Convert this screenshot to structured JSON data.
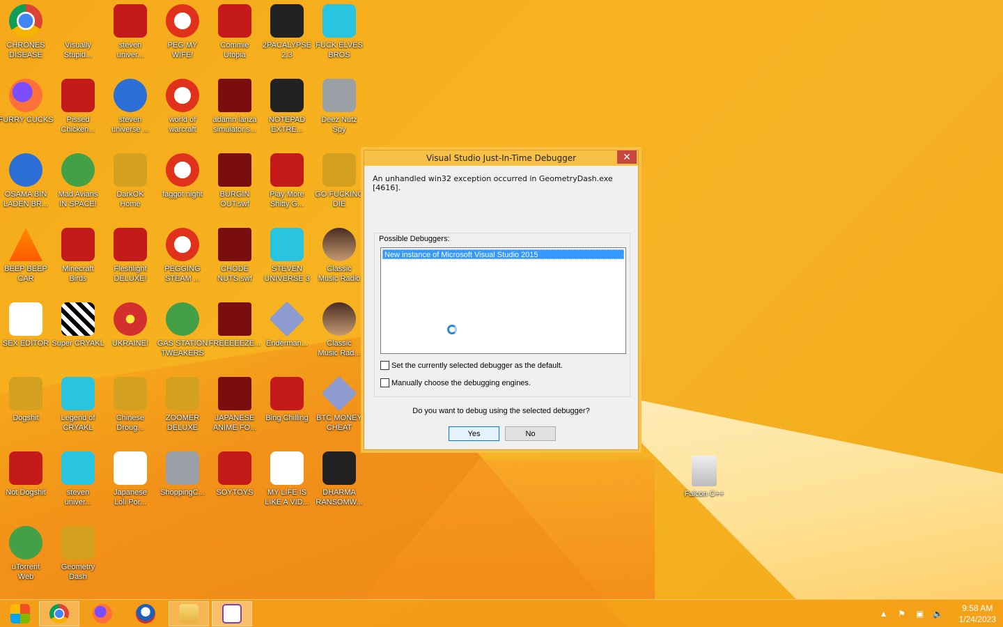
{
  "desktop": {
    "icons": [
      {
        "label": "CHRONES\nDISEASE",
        "icon": "chrome-icon"
      },
      {
        "label": "Visually\nStupid...",
        "icon": "visual-studio-icon"
      },
      {
        "label": "steven\nuniver...",
        "icon": "game-icon"
      },
      {
        "label": "PEG MY\nWIFE!",
        "icon": "peggle-icon"
      },
      {
        "label": "Commie\nUtopia",
        "icon": "eagle-icon"
      },
      {
        "label": "2PACALYPSE\n2.3",
        "icon": "terminal-icon"
      },
      {
        "label": "FUCK ELVES\nBROS",
        "icon": "elf-icon"
      },
      {
        "label": "FURRY CUCKS",
        "icon": "firefox-icon"
      },
      {
        "label": "Pissed\nChicken...",
        "icon": "angry-birds-icon"
      },
      {
        "label": "steven\nuniverse ...",
        "icon": "gem-icon"
      },
      {
        "label": "world of\nwarcraft",
        "icon": "peggle-icon"
      },
      {
        "label": "adamn lanza\nsimulator.s...",
        "icon": "flash-icon"
      },
      {
        "label": "NOTEPAD\nEXTRE...",
        "icon": "notepad-icon"
      },
      {
        "label": "Deez Nutz\nSpy",
        "icon": "windows-stack-icon"
      },
      {
        "label": "OSAMA BIN\nLADEN BR...",
        "icon": "obama-logo-icon"
      },
      {
        "label": "Mad Avians\nIN SPACE!",
        "icon": "angry-birds-space-icon"
      },
      {
        "label": "DarkOK\nHome",
        "icon": "money-bag-icon"
      },
      {
        "label": "faggot night",
        "icon": "peggle-icon"
      },
      {
        "label": "BURGIN\nOUT.swf",
        "icon": "flash-icon"
      },
      {
        "label": "Play More\nShitty G...",
        "icon": "popcap-icon"
      },
      {
        "label": "GO FUCKING\nDIE",
        "icon": "de-icon"
      },
      {
        "label": "BEEP BEEP\nCAR",
        "icon": "vlc-icon"
      },
      {
        "label": "Minecraft\nBirds",
        "icon": "angry-birds-icon"
      },
      {
        "label": "Fleshlight\nDELUXE!",
        "icon": "red-creature-icon"
      },
      {
        "label": "PEGGING\nSTEAM ...",
        "icon": "peggle-icon"
      },
      {
        "label": "CHODE\nNUTS.swf",
        "icon": "flash-icon"
      },
      {
        "label": "STEVEN\nUNIVERSE 3",
        "icon": "number-three-icon"
      },
      {
        "label": "Classic\nMusic Radio",
        "icon": "portrait-icon"
      },
      {
        "label": "SEX EDITOR",
        "icon": "hxd-icon"
      },
      {
        "label": "Super CRYAKL",
        "icon": "pixel-icon"
      },
      {
        "label": "UKRAINE!",
        "icon": "radiation-icon"
      },
      {
        "label": "GAS STATION\nTWEAKERS",
        "icon": "plant-icon"
      },
      {
        "label": "FREEEEEZE...",
        "icon": "flash-icon"
      },
      {
        "label": "Enderman...",
        "icon": "diamond-icon"
      },
      {
        "label": "Classic\nMusic Rad...",
        "icon": "portrait-icon"
      },
      {
        "label": "Dogshit",
        "icon": "plane-icon"
      },
      {
        "label": "Legend of\nCRYAKL",
        "icon": "character-icon"
      },
      {
        "label": "Chinese\nDroug...",
        "icon": "chinese-game-icon"
      },
      {
        "label": "ZOOMER\nDELUXE",
        "icon": "zuma-icon"
      },
      {
        "label": "JAPANESE\nANIME FO...",
        "icon": "flash-icon"
      },
      {
        "label": "Bing Chilling",
        "icon": "book-icon"
      },
      {
        "label": "BTC MONEY\nCHEAT",
        "icon": "diamond-icon"
      },
      {
        "label": "Not Dogshit",
        "icon": "devcpp-icon"
      },
      {
        "label": "steven\nuniver...",
        "icon": "blue-gem-icon"
      },
      {
        "label": "Japanese\nLoli Por...",
        "icon": "torii-icon"
      },
      {
        "label": "ShoppingC...",
        "icon": "flash-circle-icon"
      },
      {
        "label": "SOYTOYS",
        "icon": "s-logo-icon"
      },
      {
        "label": "MY LIFE IS\nLIKE A VID...",
        "icon": "gamepad-icon"
      },
      {
        "label": "DHARMA\nRANSOMW...",
        "icon": "skull-icon"
      },
      {
        "label": "uTorrent\nWeb",
        "icon": "utorrent-icon"
      },
      {
        "label": "Geometry\nDash",
        "icon": "geometry-dash-icon"
      }
    ],
    "recycle_bin": {
      "label": "Falcon C++",
      "icon": "recycle-bin-icon"
    }
  },
  "dialog": {
    "title": "Visual Studio Just-In-Time Debugger",
    "close_glyph": "✕",
    "message": "An unhandled win32 exception occurred in GeometryDash.exe [4616].",
    "group_label": "Possible Debuggers:",
    "debuggers": [
      "New instance of Microsoft Visual Studio 2015"
    ],
    "checkbox_default": "Set the currently selected debugger as the default.",
    "checkbox_manual": "Manually choose the debugging engines.",
    "question": "Do you want to debug using the selected debugger?",
    "yes_label": "Yes",
    "no_label": "No"
  },
  "taskbar": {
    "apps": [
      {
        "name": "start-button",
        "icon": "windows-logo-icon"
      },
      {
        "name": "chrome",
        "icon": "chrome-icon"
      },
      {
        "name": "firefox",
        "icon": "firefox-icon"
      },
      {
        "name": "obama-app",
        "icon": "obama-logo-icon"
      },
      {
        "name": "file-explorer",
        "icon": "folder-icon"
      },
      {
        "name": "visual-studio-debugger",
        "icon": "debugger-icon"
      }
    ],
    "clock_time": "9:58 AM",
    "clock_date": "1/24/2023"
  },
  "colors": {
    "accent": "#f7c046",
    "close_button": "#c7463d",
    "selection": "#3399ff"
  }
}
